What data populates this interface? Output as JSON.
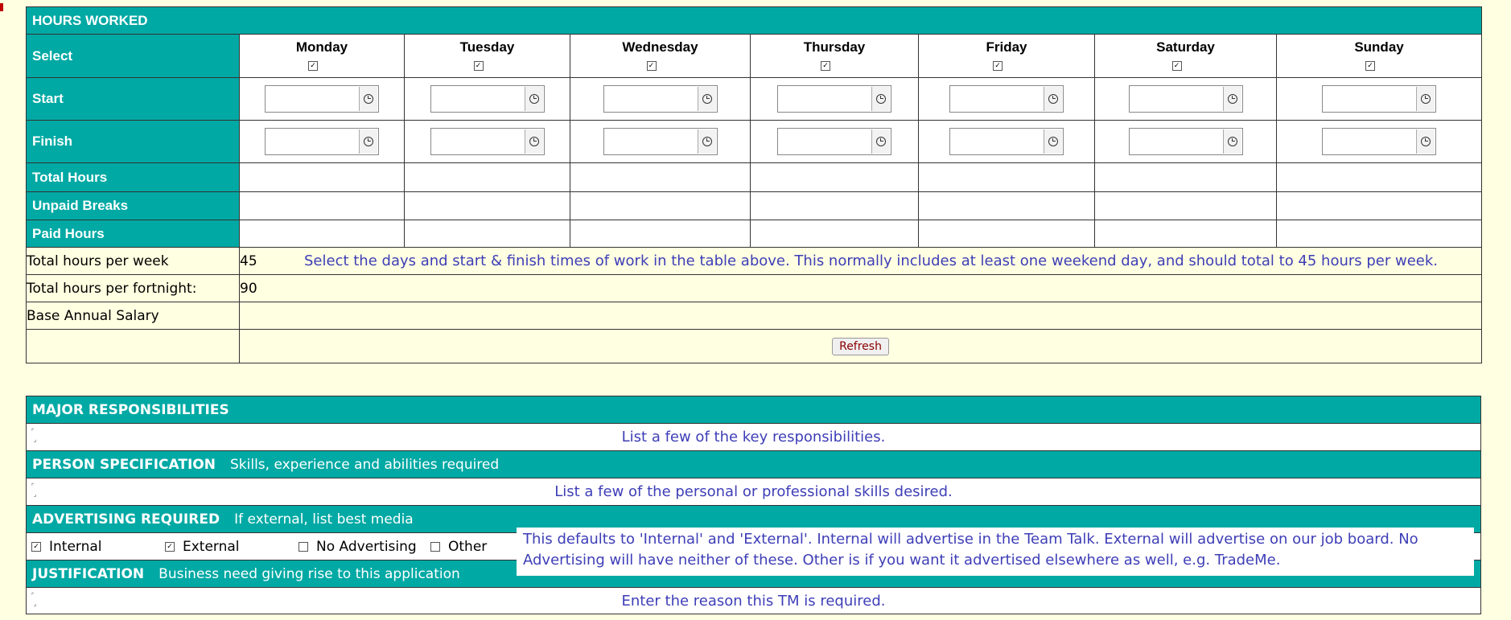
{
  "hours_worked": {
    "title": "HOURS WORKED",
    "row_labels": {
      "select": "Select",
      "start": "Start",
      "finish": "Finish",
      "total_hours": "Total Hours",
      "unpaid_breaks": "Unpaid Breaks",
      "paid_hours": "Paid Hours"
    },
    "days": [
      "Monday",
      "Tuesday",
      "Wednesday",
      "Thursday",
      "Friday",
      "Saturday",
      "Sunday"
    ],
    "days_selected": [
      true,
      true,
      true,
      true,
      true,
      true,
      true
    ],
    "summary": {
      "week_label": "Total hours per week",
      "week_value": "45",
      "week_hint": "Select the days and start & finish times of work in the table above. This normally includes at least one weekend day, and should total to 45 hours per week.",
      "fortnight_label": "Total hours per fortnight:",
      "fortnight_value": "90",
      "salary_label": "Base Annual Salary",
      "salary_value": "",
      "refresh_label": "Refresh"
    }
  },
  "major_responsibilities": {
    "title": "MAJOR RESPONSIBILITIES",
    "hint": "List a few of the key responsibilities."
  },
  "person_specification": {
    "title": "PERSON SPECIFICATION",
    "subtitle": "Skills, experience and abilities required",
    "hint": "List a few of the personal or professional skills desired."
  },
  "advertising": {
    "title": "ADVERTISING REQUIRED",
    "subtitle": "If external, list best media",
    "options": [
      {
        "label": "Internal",
        "checked": true
      },
      {
        "label": "External",
        "checked": true
      },
      {
        "label": "No Advertising",
        "checked": false
      },
      {
        "label": "Other",
        "checked": false
      }
    ],
    "note": "This defaults to 'Internal' and 'External'. Internal will advertise in the Team Talk. External will advertise on our job board. No Advertising will have neither of these. Other is if you want it advertised elsewhere as well, e.g. TradeMe."
  },
  "justification": {
    "title": "JUSTIFICATION",
    "subtitle": "Business need giving rise to this application",
    "hint": "Enter the reason this TM is required."
  },
  "colors": {
    "header_teal": "#00a9a4",
    "page_background": "#ffffe1",
    "hint_blue": "#3e3eb8",
    "refresh_text": "#8b0000"
  },
  "icons": {
    "time_picker": "clock-icon",
    "resize_grip": "resize-grip-icon"
  }
}
